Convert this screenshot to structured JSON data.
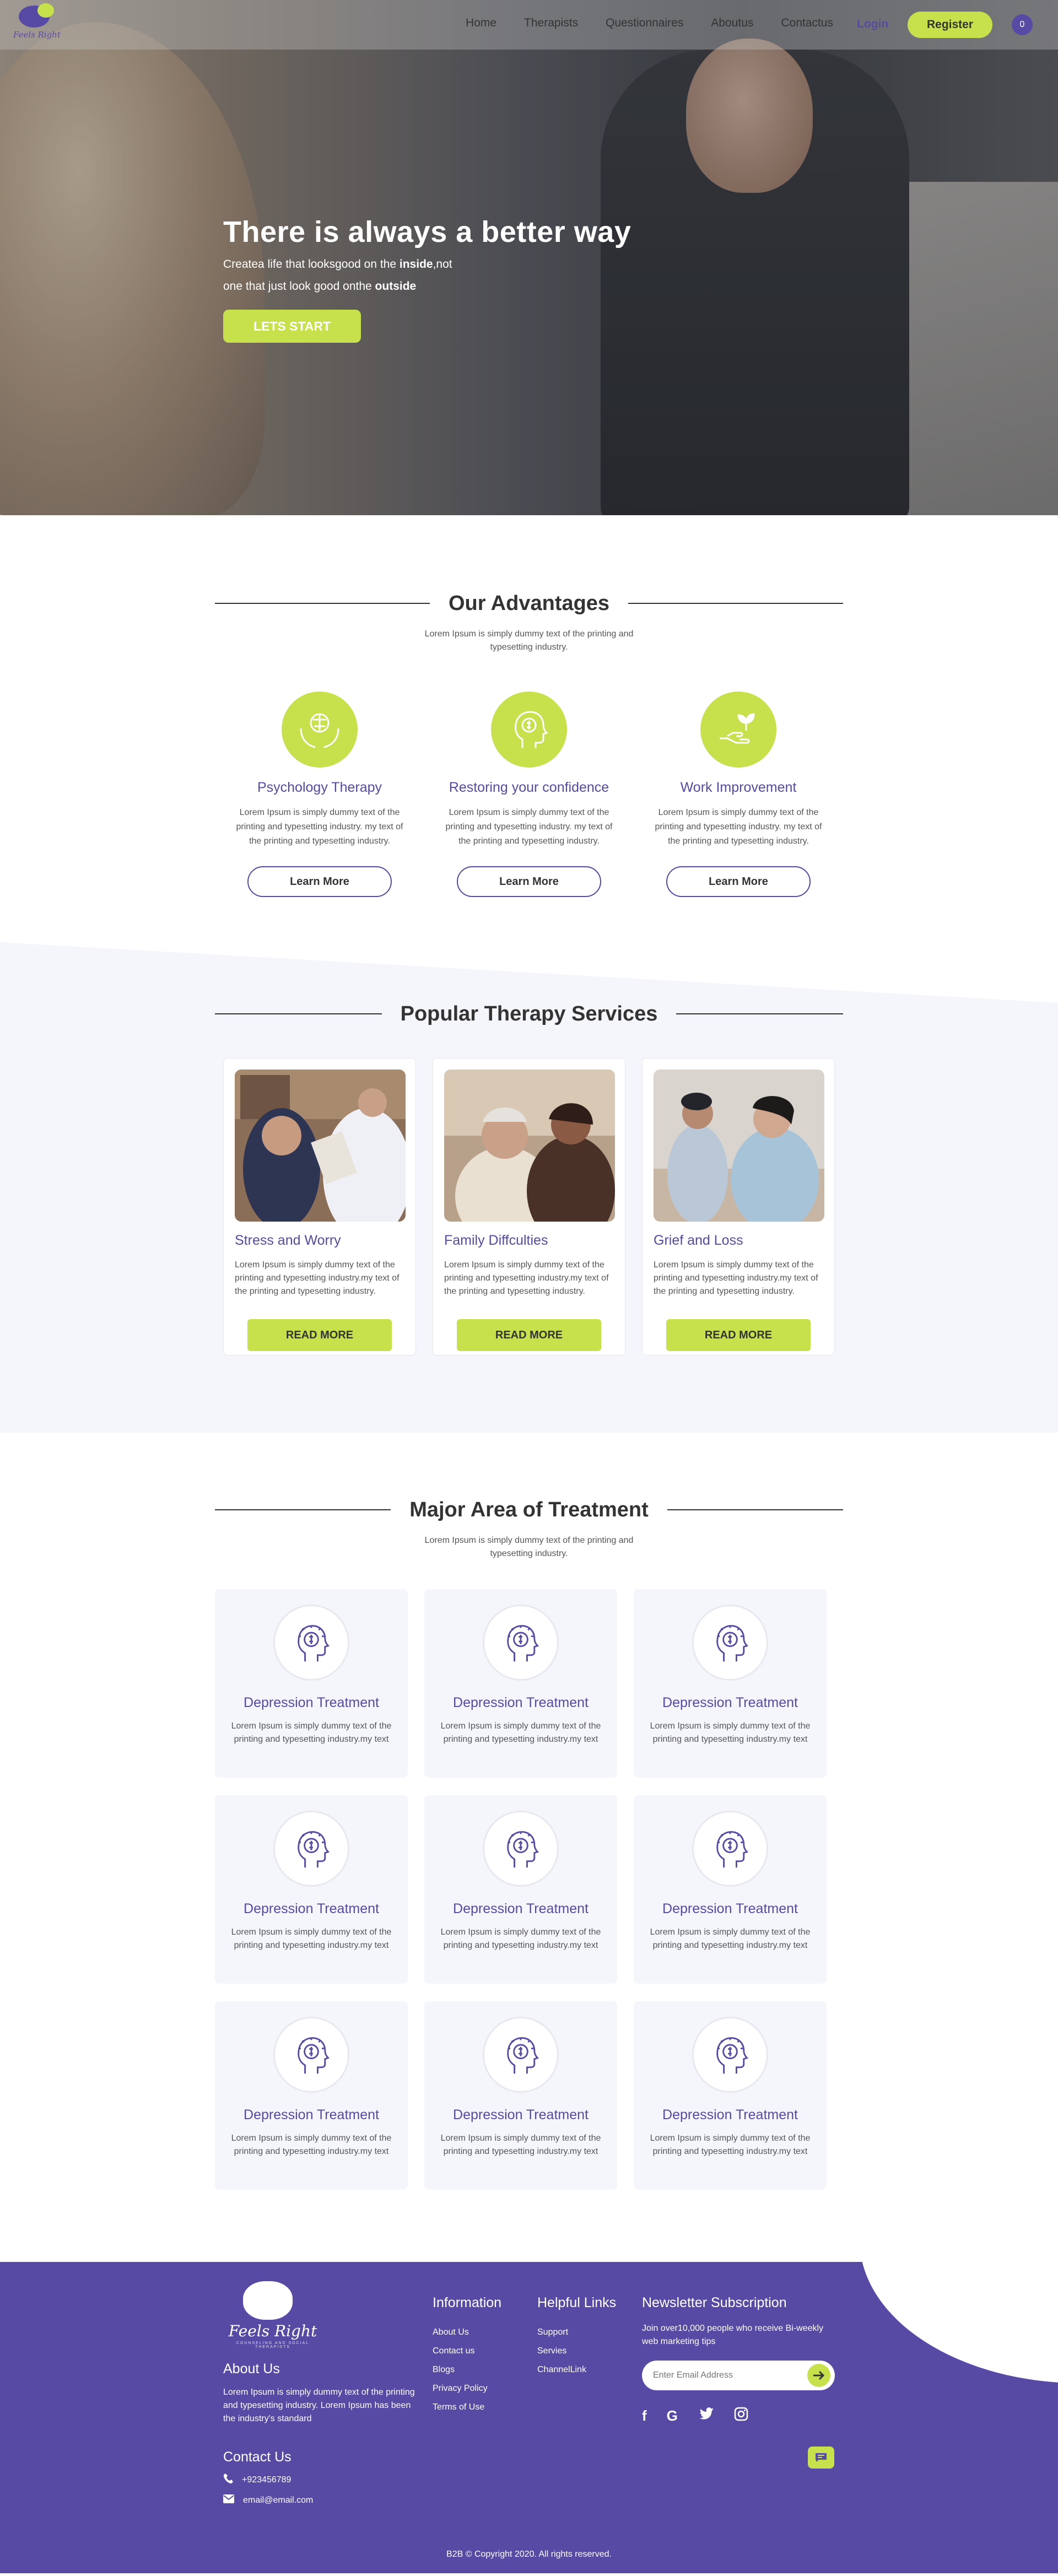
{
  "header": {
    "logo_text": "Feels Right",
    "nav": [
      "Home",
      "Therapists",
      "Questionnaires",
      "Aboutus",
      "Contactus"
    ],
    "login": "Login",
    "register": "Register",
    "cart_count": "0"
  },
  "hero": {
    "title": "There is always a better way",
    "line1_pre": "Createa life that looksgood on the ",
    "line1_bold": "inside",
    "line1_post": ",not",
    "line2_pre": "one that just look good onthe ",
    "line2_bold": "outside",
    "cta": "LETS START"
  },
  "advantages": {
    "title": "Our Advantages",
    "subtitle_l1": "Lorem Ipsum is simply dummy text of the printing and",
    "subtitle_l2": "typesetting industry.",
    "cards": [
      {
        "title": "Psychology Therapy",
        "text": "Lorem Ipsum is simply dummy text of the printing and typesetting industry. my text of the printing and typesetting industry.",
        "button": "Learn More",
        "icon": "hands-brain-icon"
      },
      {
        "title": "Restoring your confidence",
        "text": "Lorem Ipsum is simply dummy text of the printing and typesetting industry. my text of the printing and typesetting industry.",
        "button": "Learn More",
        "icon": "head-dollar-icon"
      },
      {
        "title": "Work Improvement",
        "text": "Lorem Ipsum is simply dummy text of the printing and typesetting industry. my text of the printing and typesetting industry.",
        "button": "Learn More",
        "icon": "hand-plant-icon"
      }
    ]
  },
  "popular": {
    "title": "Popular Therapy Services",
    "cards": [
      {
        "title": "Stress and Worry",
        "text": "Lorem Ipsum is simply dummy text of the printing and typesetting industry.my text of the printing and typesetting industry.",
        "button": "READ MORE"
      },
      {
        "title": "Family Diffculties",
        "text": "Lorem Ipsum is simply dummy text of the printing and typesetting industry.my text of the printing and typesetting industry.",
        "button": "READ MORE"
      },
      {
        "title": "Grief and Loss",
        "text": "Lorem Ipsum is simply dummy text of the printing and typesetting industry.my text of the printing and typesetting industry.",
        "button": "READ MORE"
      }
    ]
  },
  "major": {
    "title": "Major Area of Treatment",
    "subtitle_l1": "Lorem Ipsum is simply dummy text of the printing and",
    "subtitle_l2": "typesetting industry.",
    "cards": [
      {
        "title": "Depression Treatment",
        "text": "Lorem Ipsum is simply dummy text of the printing and typesetting industry.my text"
      },
      {
        "title": "Depression Treatment",
        "text": "Lorem Ipsum is simply dummy text of the printing and typesetting industry.my text"
      },
      {
        "title": "Depression Treatment",
        "text": "Lorem Ipsum is simply dummy text of the printing and typesetting industry.my text"
      },
      {
        "title": "Depression Treatment",
        "text": "Lorem Ipsum is simply dummy text of the printing and typesetting industry.my text"
      },
      {
        "title": "Depression Treatment",
        "text": "Lorem Ipsum is simply dummy text of the printing and typesetting industry.my text"
      },
      {
        "title": "Depression Treatment",
        "text": "Lorem Ipsum is simply dummy text of the printing and typesetting industry.my text"
      },
      {
        "title": "Depression Treatment",
        "text": "Lorem Ipsum is simply dummy text of the printing and typesetting industry.my text"
      },
      {
        "title": "Depression Treatment",
        "text": "Lorem Ipsum is simply dummy text of the printing and typesetting industry.my text"
      },
      {
        "title": "Depression Treatment",
        "text": "Lorem Ipsum is simply dummy text of the printing and typesetting industry.my text"
      }
    ]
  },
  "footer": {
    "logo_name": "Feels Right",
    "logo_tagline": "COUNSELING AND SOCIAL THERAPISTS",
    "about_title": "About Us",
    "about_text": "Lorem Ipsum is simply dummy text of the printing and typesetting industry. Lorem Ipsum has been the industry's standard",
    "contact_title": "Contact Us",
    "phone": "+923456789",
    "email": "email@email.com",
    "info_title": "Information",
    "info_links": [
      "About Us",
      "Contact us",
      "Blogs",
      "Privacy Policy",
      "Terms of Use"
    ],
    "help_title": "Helpful Links",
    "help_links": [
      "Support",
      "Servies",
      "ChannelLink"
    ],
    "news_title": "Newsletter Subscription",
    "news_text": "Join over10,000 people who receive Bi-weekly web marketing tips",
    "email_placeholder": "Enter Email Address",
    "social": [
      "f",
      "G",
      "twitter",
      "instagram"
    ],
    "copyright": "B2B © Copyright 2020. All rights reserved."
  },
  "colors": {
    "primary": "#574aa5",
    "accent": "#c6e14b",
    "section_bg": "#f5f6fb"
  }
}
